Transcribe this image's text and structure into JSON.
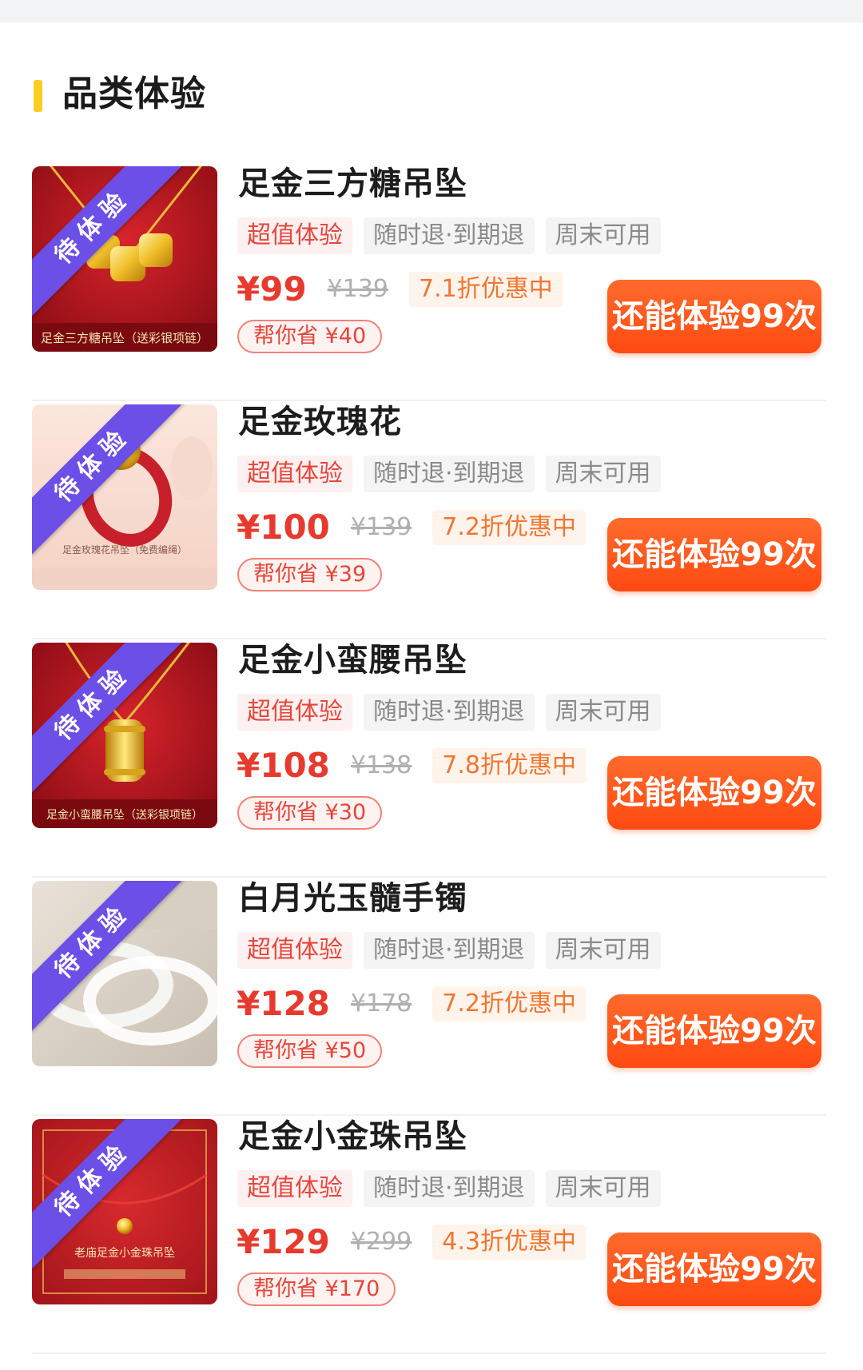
{
  "section": {
    "title": "品类体验"
  },
  "colors": {
    "accent_bar": "#ffcc22",
    "ribbon": "#6c4fe6",
    "cta": "#ff4a12",
    "price": "#e73a2e"
  },
  "items": [
    {
      "title": "足金三方糖吊坠",
      "ribbon": "待体验",
      "tags": [
        "超值体验",
        "随时退·到期退",
        "周末可用"
      ],
      "price": "¥99",
      "original_price": "¥139",
      "discount": "7.1折优惠中",
      "save": "帮你省 ¥40",
      "cta": "还能体验99次",
      "image_caption": "足金三方糖吊坠（送彩银项链）",
      "image_icon": "gold-cube-pendant-icon"
    },
    {
      "title": "足金玫瑰花",
      "ribbon": "待体验",
      "tags": [
        "超值体验",
        "随时退·到期退",
        "周末可用"
      ],
      "price": "¥100",
      "original_price": "¥139",
      "discount": "7.2折优惠中",
      "save": "帮你省 ¥39",
      "cta": "还能体验99次",
      "image_caption": "足金玫瑰花吊坠（免费编绳）",
      "image_icon": "gold-rose-ring-icon"
    },
    {
      "title": "足金小蛮腰吊坠",
      "ribbon": "待体验",
      "tags": [
        "超值体验",
        "随时退·到期退",
        "周末可用"
      ],
      "price": "¥108",
      "original_price": "¥138",
      "discount": "7.8折优惠中",
      "save": "帮你省 ¥30",
      "cta": "还能体验99次",
      "image_caption": "足金小蛮腰吊坠（送彩银项链）",
      "image_icon": "gold-waist-pendant-icon"
    },
    {
      "title": "白月光玉髓手镯",
      "ribbon": "待体验",
      "tags": [
        "超值体验",
        "随时退·到期退",
        "周末可用"
      ],
      "price": "¥128",
      "original_price": "¥178",
      "discount": "7.2折优惠中",
      "save": "帮你省 ¥50",
      "cta": "还能体验99次",
      "image_caption": "",
      "image_icon": "jade-bangle-icon"
    },
    {
      "title": "足金小金珠吊坠",
      "ribbon": "待体验",
      "tags": [
        "超值体验",
        "随时退·到期退",
        "周末可用"
      ],
      "price": "¥129",
      "original_price": "¥299",
      "discount": "4.3折优惠中",
      "save": "帮你省 ¥170",
      "cta": "还能体验99次",
      "image_caption": "老庙足金小金珠吊坠",
      "image_icon": "gold-bead-pendant-icon"
    }
  ]
}
